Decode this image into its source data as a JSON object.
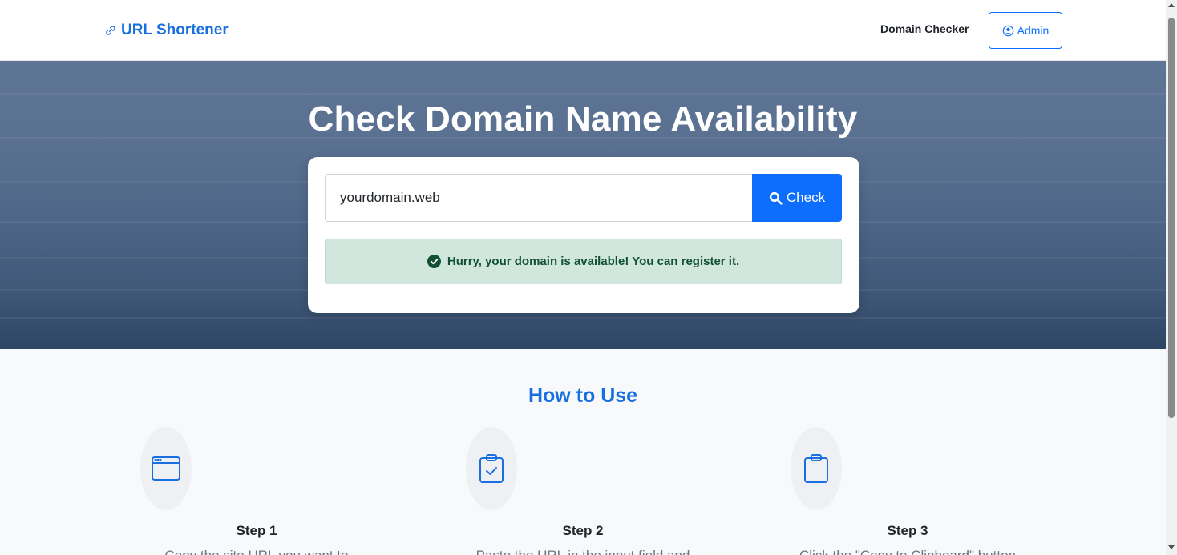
{
  "navbar": {
    "brand": "URL Shortener",
    "brand_icon": "link-icon",
    "links": [
      "Domain Checker"
    ],
    "admin_label": "Admin",
    "admin_icon": "user-circle-icon"
  },
  "hero": {
    "title": "Check Domain Name Availability",
    "input_value": "yourdomain.web",
    "check_label": "Check",
    "check_icon": "search-icon",
    "alert_text": "Hurry, your domain is available! You can register it.",
    "alert_icon": "check-circle-icon"
  },
  "howto": {
    "title": "How to Use",
    "steps": [
      {
        "title": "Step 1",
        "desc": "Copy the site URL you want to",
        "icon": "browser-window-icon"
      },
      {
        "title": "Step 2",
        "desc": "Paste the URL in the input field and",
        "icon": "clipboard-check-icon"
      },
      {
        "title": "Step 3",
        "desc": "Click the \"Copy to Clipboard\" button",
        "icon": "clipboard-icon"
      }
    ]
  },
  "colors": {
    "primary": "#0d6efd",
    "brand": "#1a6fe0",
    "success_bg": "#d1e7dd",
    "success_text": "#0f5132"
  }
}
